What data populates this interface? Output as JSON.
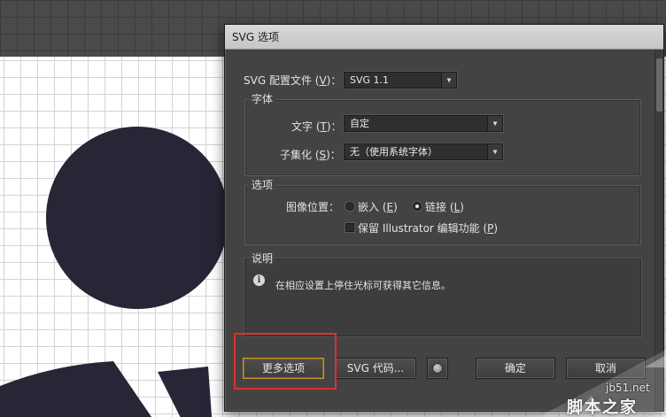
{
  "dialog": {
    "title": "SVG 选项",
    "profile": {
      "label_pre": "SVG 配置文件 (",
      "label_key": "V",
      "label_post": ")：",
      "value": "SVG 1.1"
    },
    "font_group": {
      "title": "字体",
      "text_label_pre": "文字 (",
      "text_label_key": "T",
      "text_label_post": ")：",
      "text_value": "自定",
      "subset_label_pre": "子集化 (",
      "subset_label_key": "S",
      "subset_label_post": ")：",
      "subset_value": "无（使用系统字体）"
    },
    "options_group": {
      "title": "选项",
      "image_location_label": "图像位置：",
      "embed_pre": "嵌入 (",
      "embed_key": "E",
      "embed_post": ")",
      "link_pre": "链接 (",
      "link_key": "L",
      "link_post": ")",
      "link_selected": true,
      "preserve_pre": "保留 Illustrator 编辑功能 (",
      "preserve_key": "P",
      "preserve_post": ")",
      "preserve_checked": false
    },
    "description_group": {
      "title": "说明",
      "text": "在相应设置上停住光标可获得其它信息。"
    },
    "buttons": {
      "more_options": "更多选项",
      "svg_code": "SVG 代码...",
      "ok": "确定",
      "cancel": "取消"
    }
  },
  "watermark": {
    "site": "jb51.net",
    "name": "脚本之家"
  },
  "colors": {
    "shape_fill": "#272536",
    "highlight": "#e0302c",
    "dialog_bg": "#434343"
  },
  "icons": {
    "info": "info-icon",
    "web_preview": "globe-icon",
    "dropdown": "triangle-down-icon"
  }
}
